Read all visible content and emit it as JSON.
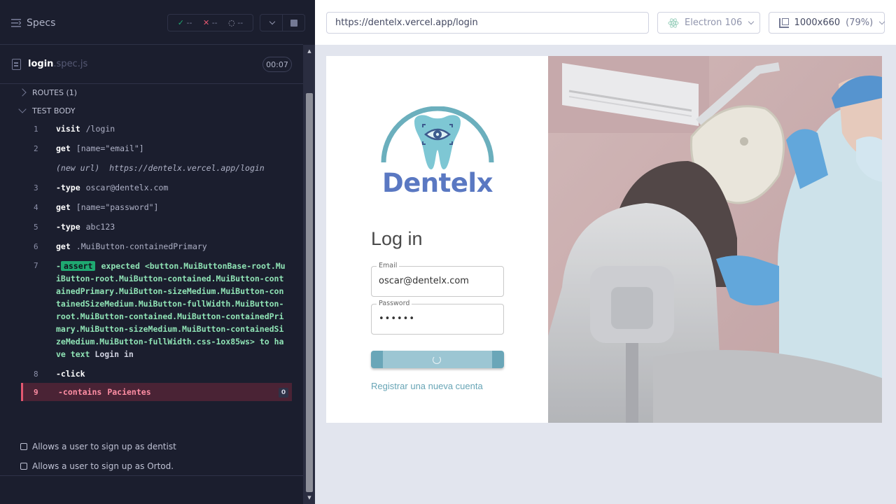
{
  "runner": {
    "specs_label": "Specs",
    "stats": {
      "passed": "--",
      "failed": "--",
      "pending": "--"
    },
    "spec": {
      "name": "login",
      "ext": ".spec.js",
      "duration": "00:07"
    },
    "sections": {
      "routes": "ROUTES (1)",
      "test_body": "TEST BODY"
    },
    "commands": [
      {
        "num": "1",
        "name": "visit",
        "arg": "/login"
      },
      {
        "num": "2",
        "name": "get",
        "arg": "[name=\"email\"]"
      },
      {
        "note_label": "(new url)",
        "note_url": "https://dentelx.vercel.app/login"
      },
      {
        "num": "3",
        "name": "-type",
        "arg": "oscar@dentelx.com"
      },
      {
        "num": "4",
        "name": "get",
        "arg": "[name=\"password\"]"
      },
      {
        "num": "5",
        "name": "-type",
        "arg": "abc123"
      },
      {
        "num": "6",
        "name": "get",
        "arg": ".MuiButton-containedPrimary"
      },
      {
        "num": "7",
        "prefix": "-",
        "badge": "assert",
        "expected": "expected",
        "subject": "<button.MuiButtonBase-root.MuiButton-root.MuiButton-contained.MuiButton-containedPrimary.MuiButton-sizeMedium.MuiButton-containedSizeMedium.MuiButton-fullWidth.MuiButton-root.MuiButton-contained.MuiButton-containedPrimary.MuiButton-sizeMedium.MuiButton-containedSizeMedium.MuiButton-fullWidth.css-1ox85ws>",
        "to_have": "to have text",
        "value": "Login in"
      },
      {
        "num": "8",
        "name": "-click",
        "arg": ""
      },
      {
        "num": "9",
        "name": "-contains",
        "arg": "Pacientes",
        "count": "0"
      }
    ],
    "tests": [
      "Allows a user to sign up as dentist",
      "Allows a user to sign up as Ortod."
    ]
  },
  "aut": {
    "url": "https://dentelx.vercel.app/login",
    "browser": "Electron 106",
    "viewport": "1000x660",
    "zoom": "(79%)",
    "app": {
      "brand": "Dentelx",
      "login_title": "Log in",
      "email_label": "Email",
      "email_value": "oscar@dentelx.com",
      "password_label": "Password",
      "password_value": "••••••",
      "register_link": "Registrar una nueva cuenta"
    }
  },
  "colors": {
    "accent_pass": "#1fa971",
    "accent_fail": "#e45770",
    "brand_blue": "#5a78c2",
    "teal": "#68a5b6"
  }
}
